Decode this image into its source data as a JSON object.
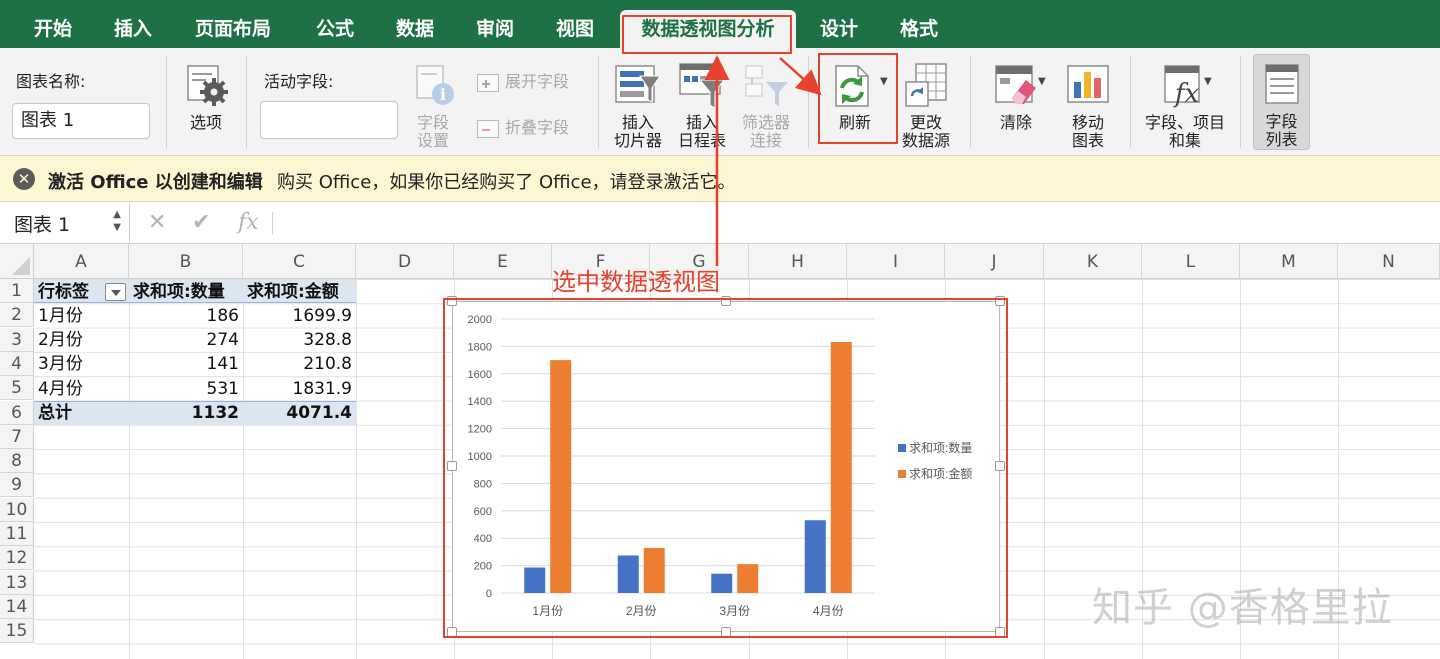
{
  "tabs": [
    {
      "label": "开始"
    },
    {
      "label": "插入"
    },
    {
      "label": "页面布局"
    },
    {
      "label": "公式"
    },
    {
      "label": "数据"
    },
    {
      "label": "审阅"
    },
    {
      "label": "视图"
    },
    {
      "label": "数据透视图分析",
      "active": true
    },
    {
      "label": "设计"
    },
    {
      "label": "格式"
    }
  ],
  "ribbon": {
    "chart_name_label": "图表名称:",
    "chart_name_value": "图表 1",
    "options_label": "选项",
    "active_field_label": "活动字段:",
    "active_field_value": "",
    "field_settings_label": "字段\n设置",
    "expand_field_label": "展开字段",
    "collapse_field_label": "折叠字段",
    "insert_slicer_label": "插入\n切片器",
    "insert_timeline_label": "插入\n日程表",
    "filter_connections_label": "筛选器\n连接",
    "refresh_label": "刷新",
    "change_source_label": "更改\n数据源",
    "clear_label": "清除",
    "move_chart_label": "移动\n图表",
    "fields_items_sets_label": "字段、项目\n和集",
    "field_list_label": "字段\n列表"
  },
  "message_bar": {
    "title": "激活 Office 以创建和编辑",
    "text": "购买 Office，如果你已经购买了 Office，请登录激活它。"
  },
  "formula_bar": {
    "name_box": "图表 1",
    "cancel_symbol": "✕",
    "enter_symbol": "✔",
    "fx_symbol": "fx",
    "formula": ""
  },
  "columns": [
    "A",
    "B",
    "C",
    "D",
    "E",
    "F",
    "G",
    "H",
    "I",
    "J",
    "K",
    "L",
    "M",
    "N"
  ],
  "rows": [
    "1",
    "2",
    "3",
    "4",
    "5",
    "6",
    "7",
    "8",
    "9",
    "10",
    "11",
    "12",
    "13",
    "14",
    "15"
  ],
  "pivot": {
    "headers": [
      "行标签",
      "求和项:数量",
      "求和项:金额"
    ],
    "rows": [
      [
        "1月份",
        "186",
        "1699.9"
      ],
      [
        "2月份",
        "274",
        "328.8"
      ],
      [
        "3月份",
        "141",
        "210.8"
      ],
      [
        "4月份",
        "531",
        "1831.9"
      ]
    ],
    "total": [
      "总计",
      "1132",
      "4071.4"
    ]
  },
  "annotation": {
    "text": "选中数据透视图"
  },
  "watermark": "知乎 @香格里拉",
  "colors": {
    "excel_green": "#1e7145",
    "series_qty": "#4472c4",
    "series_amount": "#ed7d31",
    "annotation_red": "#e8412c"
  },
  "chart_data": {
    "type": "bar",
    "categories": [
      "1月份",
      "2月份",
      "3月份",
      "4月份"
    ],
    "series": [
      {
        "name": "求和项:数量",
        "values": [
          186,
          274,
          141,
          531
        ]
      },
      {
        "name": "求和项:金额",
        "values": [
          1699.9,
          328.8,
          210.8,
          1831.9
        ]
      }
    ],
    "yticks": [
      "0",
      "200",
      "400",
      "600",
      "800",
      "1000",
      "1200",
      "1400",
      "1600",
      "1800",
      "2000"
    ],
    "ylim": [
      0,
      2000
    ],
    "grid": true,
    "legend": "right"
  }
}
